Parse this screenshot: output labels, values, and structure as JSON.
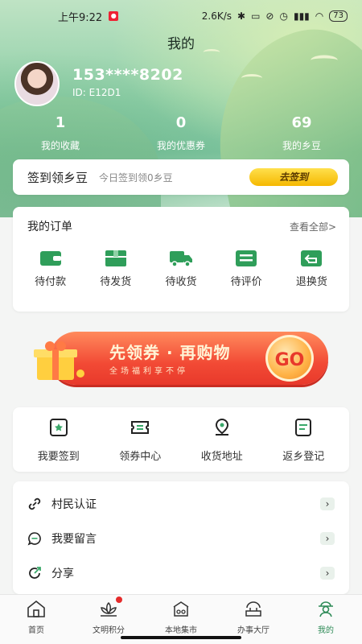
{
  "status_bar": {
    "time": "上午9:22",
    "network_speed": "2.6K/s",
    "battery": "73"
  },
  "page_title": "我的",
  "profile": {
    "phone": "153****8202",
    "id_text": "ID: E12D1"
  },
  "stats": [
    {
      "value": "1",
      "label": "我的收藏"
    },
    {
      "value": "0",
      "label": "我的优惠券"
    },
    {
      "value": "69",
      "label": "我的乡豆"
    }
  ],
  "signin": {
    "title": "签到领乡豆",
    "subtitle": "今日签到领0乡豆",
    "button": "去签到"
  },
  "orders": {
    "title": "我的订单",
    "view_all": "查看全部>",
    "items": [
      {
        "label": "待付款",
        "icon": "wallet-icon"
      },
      {
        "label": "待发货",
        "icon": "box-icon"
      },
      {
        "label": "待收货",
        "icon": "truck-icon"
      },
      {
        "label": "待评价",
        "icon": "comment-icon"
      },
      {
        "label": "退换货",
        "icon": "return-icon"
      }
    ]
  },
  "banner": {
    "title": "先领券 · 再购物",
    "subtitle": "全场福利享不停",
    "go": "GO"
  },
  "tools": [
    {
      "label": "我要签到",
      "icon": "signin-star-icon"
    },
    {
      "label": "领券中心",
      "icon": "coupon-icon"
    },
    {
      "label": "收货地址",
      "icon": "location-icon"
    },
    {
      "label": "返乡登记",
      "icon": "register-icon"
    }
  ],
  "list": [
    {
      "label": "村民认证",
      "icon": "link-icon"
    },
    {
      "label": "我要留言",
      "icon": "message-icon"
    },
    {
      "label": "分享",
      "icon": "share-icon"
    }
  ],
  "tabs": [
    {
      "label": "首页",
      "icon": "home-icon"
    },
    {
      "label": "文明积分",
      "icon": "lotus-icon"
    },
    {
      "label": "本地集市",
      "icon": "market-icon"
    },
    {
      "label": "办事大厅",
      "icon": "hall-icon"
    },
    {
      "label": "我的",
      "icon": "farmer-icon",
      "active": true
    }
  ],
  "colors": {
    "accent_green": "#2e8b57",
    "signin_yellow": "#f5b800",
    "banner_red": "#e8392b"
  }
}
